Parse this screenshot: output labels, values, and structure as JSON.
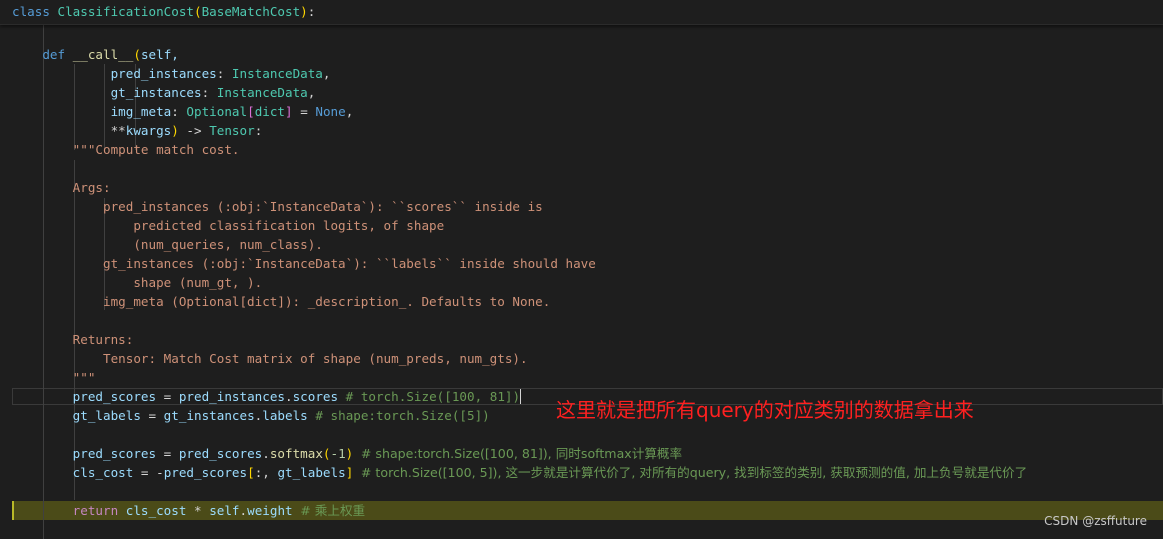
{
  "editor": {
    "sticky_header": {
      "keyword": "class",
      "class_name": "ClassificationCost",
      "base_class": "BaseMatchCost"
    },
    "code": {
      "def_kw": "def",
      "func_name": "__call__",
      "self_param": "self,",
      "params": [
        {
          "name": "pred_instances",
          "type": "InstanceData",
          "tail": ","
        },
        {
          "name": "gt_instances",
          "type": "InstanceData",
          "tail": ","
        },
        {
          "name": "img_meta",
          "type": "Optional",
          "sub": "dict",
          "default": "None",
          "tail": ","
        }
      ],
      "kwargs_prefix": "**",
      "kwargs_name": "kwargs",
      "return_arrow": " -> ",
      "return_type": "Tensor",
      "docstring": [
        "\"\"\"Compute match cost.",
        "",
        "Args:",
        "    pred_instances (:obj:`InstanceData`): ``scores`` inside is",
        "        predicted classification logits, of shape",
        "        (num_queries, num_class).",
        "    gt_instances (:obj:`InstanceData`): ``labels`` inside should have",
        "        shape (num_gt, ).",
        "    img_meta (Optional[dict]): _description_. Defaults to None.",
        "",
        "Returns:",
        "    Tensor: Match Cost matrix of shape (num_preds, num_gts).",
        "\"\"\""
      ],
      "line_pred_scores": {
        "var": "pred_scores",
        "src": "pred_instances",
        "attr": "scores",
        "comment": "# torch.Size([100, 81])"
      },
      "line_gt_labels": {
        "var": "gt_labels",
        "src": "gt_instances",
        "attr": "labels",
        "comment": "# shape:torch.Size([5])"
      },
      "line_softmax": {
        "var": "pred_scores",
        "src": "pred_scores",
        "method": "softmax",
        "arg": "-1",
        "comment": "# shape:torch.Size([100, 81]), 同时softmax计算概率"
      },
      "line_cls_cost": {
        "var": "cls_cost",
        "src": "pred_scores",
        "idx2": "gt_labels",
        "comment": "# torch.Size([100, 5]), 这一步就是计算代价了, 对所有的query, 找到标签的类别, 获取预测的值, 加上负号就是代价了"
      },
      "line_return": {
        "kw": "return",
        "var": "cls_cost",
        "obj": "self",
        "attr": "weight",
        "comment": "# 乘上权重"
      }
    }
  },
  "annotation": "这里就是把所有query的对应类别的数据拿出来",
  "watermark": "CSDN @zsffuture",
  "colors": {
    "background": "#1e1e1e",
    "keyword": "#569cd6",
    "class": "#4ec9b0",
    "function": "#dcdcaa",
    "variable": "#9cdcfe",
    "string": "#ce9178",
    "number": "#b5cea8",
    "comment": "#6a9955",
    "annotation": "#ff2020"
  }
}
